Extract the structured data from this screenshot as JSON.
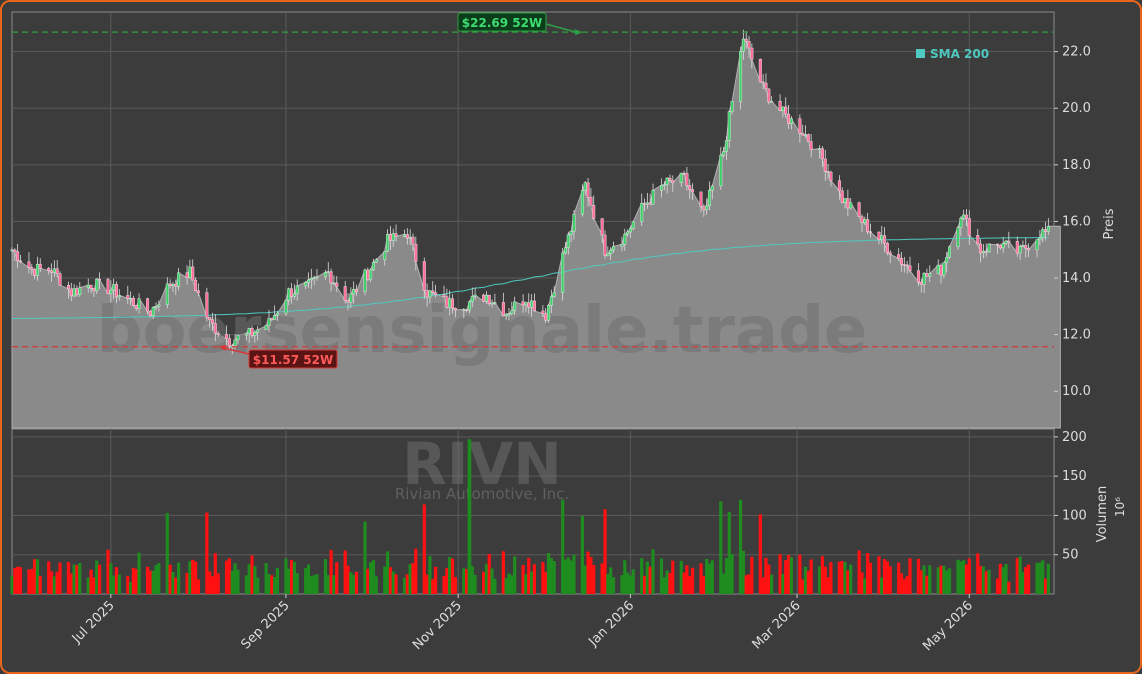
{
  "chart_data": {
    "type": "candlestick",
    "ticker": "RIVN",
    "company": "Rivian Automotive, Inc.",
    "watermark": "boersensignale.trade",
    "x_tick_labels": [
      "Jul 2025",
      "Sep 2025",
      "Nov 2025",
      "Jan 2026",
      "Mar 2026",
      "May 2026"
    ],
    "x_tick_dates": [
      "2025-07-01",
      "2025-09-01",
      "2025-11-01",
      "2026-01-01",
      "2026-03-01",
      "2026-05-01"
    ],
    "x_range": [
      "2025-05-27",
      "2026-05-31"
    ],
    "price_axis": {
      "label": "Preis",
      "ylim": [
        8.7,
        23.4
      ],
      "ticks": [
        "10.0",
        "12.0",
        "14.0",
        "16.0",
        "18.0",
        "20.0",
        "22.0"
      ]
    },
    "volume_axis": {
      "label": "Volumen",
      "unit_label": "10⁶",
      "ylim": [
        0,
        210
      ],
      "ticks": [
        "50",
        "100",
        "150",
        "200"
      ]
    },
    "high_52w": {
      "value": 22.69,
      "label": "$22.69 52W",
      "date": "2025-12-15"
    },
    "low_52w": {
      "value": 11.57,
      "label": "$11.57 52W",
      "date": "2025-08-08"
    },
    "legend": [
      {
        "name": "SMA 200",
        "color": "#4fc9c0",
        "placement": "top-right"
      }
    ],
    "grid": true,
    "colors": {
      "up": "#1f8c1f",
      "down": "#ff1111",
      "high_line": "#2ea043",
      "low_line": "#d93838",
      "sma": "#4fc9c0",
      "area": "#8a8a8a",
      "background": "#3c3c3c"
    },
    "close_keypoints": [
      [
        "2025-05-27",
        15.0
      ],
      [
        "2025-06-03",
        14.3
      ],
      [
        "2025-06-10",
        14.3
      ],
      [
        "2025-06-17",
        13.5
      ],
      [
        "2025-06-24",
        13.8
      ],
      [
        "2025-07-01",
        13.6
      ],
      [
        "2025-07-08",
        13.2
      ],
      [
        "2025-07-15",
        12.8
      ],
      [
        "2025-07-22",
        13.8
      ],
      [
        "2025-07-29",
        14.2
      ],
      [
        "2025-08-05",
        12.4
      ],
      [
        "2025-08-12",
        11.8
      ],
      [
        "2025-08-19",
        12.0
      ],
      [
        "2025-08-26",
        12.4
      ],
      [
        "2025-09-02",
        13.5
      ],
      [
        "2025-09-09",
        13.7
      ],
      [
        "2025-09-16",
        14.2
      ],
      [
        "2025-09-23",
        13.2
      ],
      [
        "2025-09-30",
        14.2
      ],
      [
        "2025-10-07",
        15.3
      ],
      [
        "2025-10-14",
        15.6
      ],
      [
        "2025-10-21",
        13.5
      ],
      [
        "2025-10-28",
        13.1
      ],
      [
        "2025-11-04",
        13.1
      ],
      [
        "2025-11-11",
        13.4
      ],
      [
        "2025-11-18",
        12.8
      ],
      [
        "2025-11-25",
        13.3
      ],
      [
        "2025-12-02",
        12.7
      ],
      [
        "2025-12-09",
        15.1
      ],
      [
        "2025-12-16",
        17.3
      ],
      [
        "2025-12-23",
        15.0
      ],
      [
        "2025-12-30",
        15.5
      ],
      [
        "2026-01-06",
        16.6
      ],
      [
        "2026-01-13",
        17.3
      ],
      [
        "2026-01-20",
        17.5
      ],
      [
        "2026-01-27",
        16.2
      ],
      [
        "2026-02-03",
        18.5
      ],
      [
        "2026-02-10",
        22.5
      ],
      [
        "2026-02-17",
        20.7
      ],
      [
        "2026-02-24",
        19.8
      ],
      [
        "2026-03-03",
        19.2
      ],
      [
        "2026-03-10",
        18.2
      ],
      [
        "2026-03-17",
        16.8
      ],
      [
        "2026-03-24",
        16.0
      ],
      [
        "2026-03-31",
        15.3
      ],
      [
        "2026-04-07",
        14.6
      ],
      [
        "2026-04-14",
        14.0
      ],
      [
        "2026-04-21",
        14.3
      ],
      [
        "2026-04-28",
        16.3
      ],
      [
        "2026-05-05",
        15.0
      ],
      [
        "2026-05-12",
        15.2
      ],
      [
        "2026-05-19",
        14.9
      ],
      [
        "2026-05-26",
        15.6
      ]
    ]
  }
}
